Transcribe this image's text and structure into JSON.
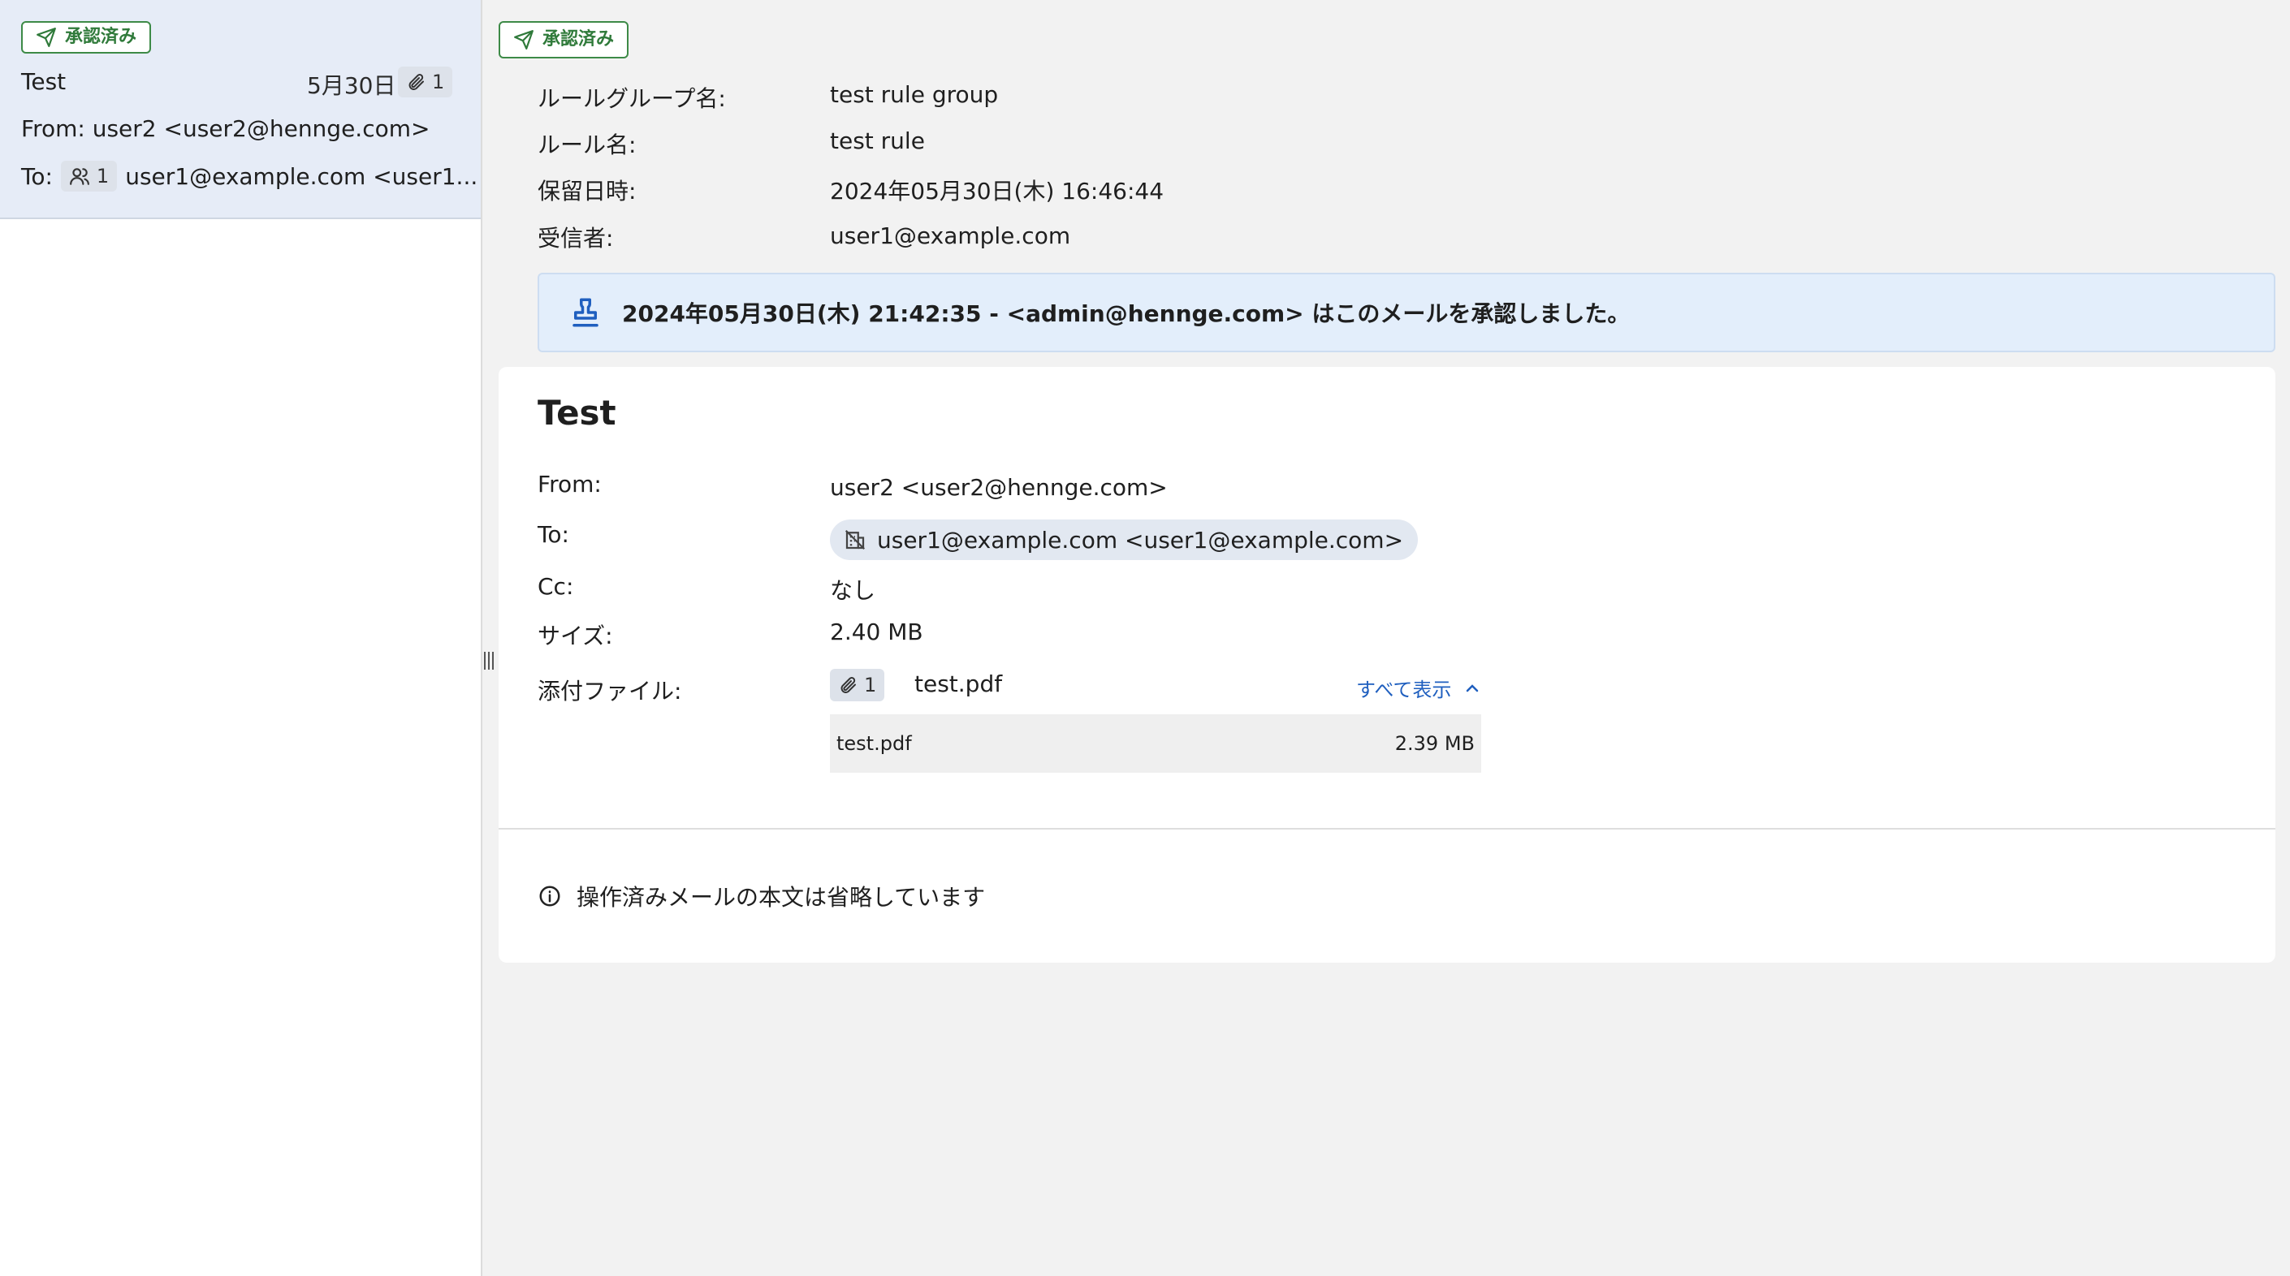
{
  "list": {
    "item": {
      "status": "承認済み",
      "subject": "Test",
      "date": "5月30日",
      "attachment_count": "1",
      "from": "From: user2 <user2@hennge.com>",
      "to_label": "To:",
      "recipient_count": "1",
      "to_value": "user1@example.com <user1..."
    }
  },
  "detail": {
    "status": "承認済み",
    "meta": [
      {
        "label": "ルールグループ名:",
        "value": "test rule group"
      },
      {
        "label": "ルール名:",
        "value": "test rule"
      },
      {
        "label": "保留日時:",
        "value": "2024年05月30日(木) 16:46:44"
      },
      {
        "label": "受信者:",
        "value": "user1@example.com"
      }
    ],
    "approval_message": "2024年05月30日(木) 21:42:35 - <admin@hennge.com> はこのメールを承認しました。",
    "mail": {
      "subject": "Test",
      "from_label": "From:",
      "from_value": "user2 <user2@hennge.com>",
      "to_label": "To:",
      "to_value": "user1@example.com <user1@example.com>",
      "cc_label": "Cc:",
      "cc_value": "なし",
      "size_label": "サイズ:",
      "size_value": "2.40 MB",
      "attachments_label": "添付ファイル:",
      "attachment_count": "1",
      "attachment_name": "test.pdf",
      "show_all": "すべて表示",
      "attachment_rows": [
        {
          "name": "test.pdf",
          "size": "2.39 MB"
        }
      ],
      "body_note": "操作済みメールの本文は省略しています"
    }
  },
  "colors": {
    "approved_green": "#2f7a3a",
    "selected_row": "#e6ecf7",
    "info_bar": "#e3eefb",
    "link_blue": "#1f5fbf"
  }
}
